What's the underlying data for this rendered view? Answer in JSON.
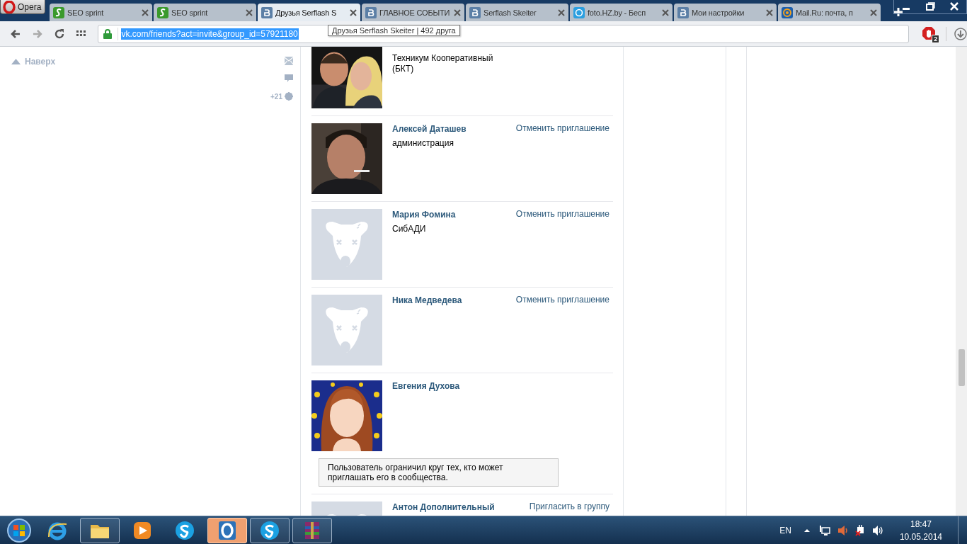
{
  "browser": {
    "menu_label": "Opera",
    "tabs": [
      {
        "title": "SEO sprint",
        "kind": "seo",
        "selected": false
      },
      {
        "title": "SEO sprint",
        "kind": "seo",
        "selected": false
      },
      {
        "title": "Друзья Serflash S",
        "kind": "vk",
        "selected": true
      },
      {
        "title": "ГЛАВНОЕ СОБЫТИ",
        "kind": "vk",
        "selected": false
      },
      {
        "title": "Serflash Skeiter",
        "kind": "vk",
        "selected": false
      },
      {
        "title": "foto.HZ.by - Бесп",
        "kind": "foto",
        "selected": false
      },
      {
        "title": "Мои настройки",
        "kind": "vk",
        "selected": false
      },
      {
        "title": "Mail.Ru: почта, п",
        "kind": "mail",
        "selected": false
      }
    ],
    "address_bar": {
      "url": "vk.com/friends?act=invite&group_id=57921180",
      "url_selected": true
    },
    "tooltip": "Друзья Serflash Skeiter | 492 друга",
    "adblock_count": "2"
  },
  "sidebar": {
    "back_to_top": "Наверх",
    "counter": "+21"
  },
  "friends": [
    {
      "info": "Техникум Кооперативный (БКТ)"
    },
    {
      "name": "Алексей Даташев",
      "info": "администрация",
      "action": "Отменить приглашение"
    },
    {
      "avatar": {
        "kind": "placeholder"
      },
      "name": "Мария Фомина",
      "info": "СибАДИ",
      "action": "Отменить приглашение"
    },
    {
      "avatar": {
        "kind": "placeholder"
      },
      "name": "Ника Медведева",
      "action": "Отменить приглашение"
    },
    {
      "name": "Евгения Духова",
      "notice": "Пользователь ограничил круг тех, кто может приглашать его в сообщества."
    },
    {
      "avatar": {
        "kind": "placeholder"
      },
      "name": "Антон Дополнительный",
      "action": "Пригласить в группу"
    }
  ],
  "taskbar": {
    "apps": [
      {
        "kind": "ie",
        "running": false,
        "selected": false
      },
      {
        "kind": "folder",
        "running": true,
        "selected": false
      },
      {
        "kind": "media",
        "running": false,
        "selected": false
      },
      {
        "kind": "skype",
        "running": false,
        "selected": false
      },
      {
        "kind": "opera",
        "running": true,
        "selected": true
      },
      {
        "kind": "skype",
        "running": true,
        "selected": false
      },
      {
        "kind": "archive",
        "running": true,
        "selected": false
      }
    ],
    "language": "EN",
    "time": "18:47",
    "date": "10.05.2014"
  }
}
